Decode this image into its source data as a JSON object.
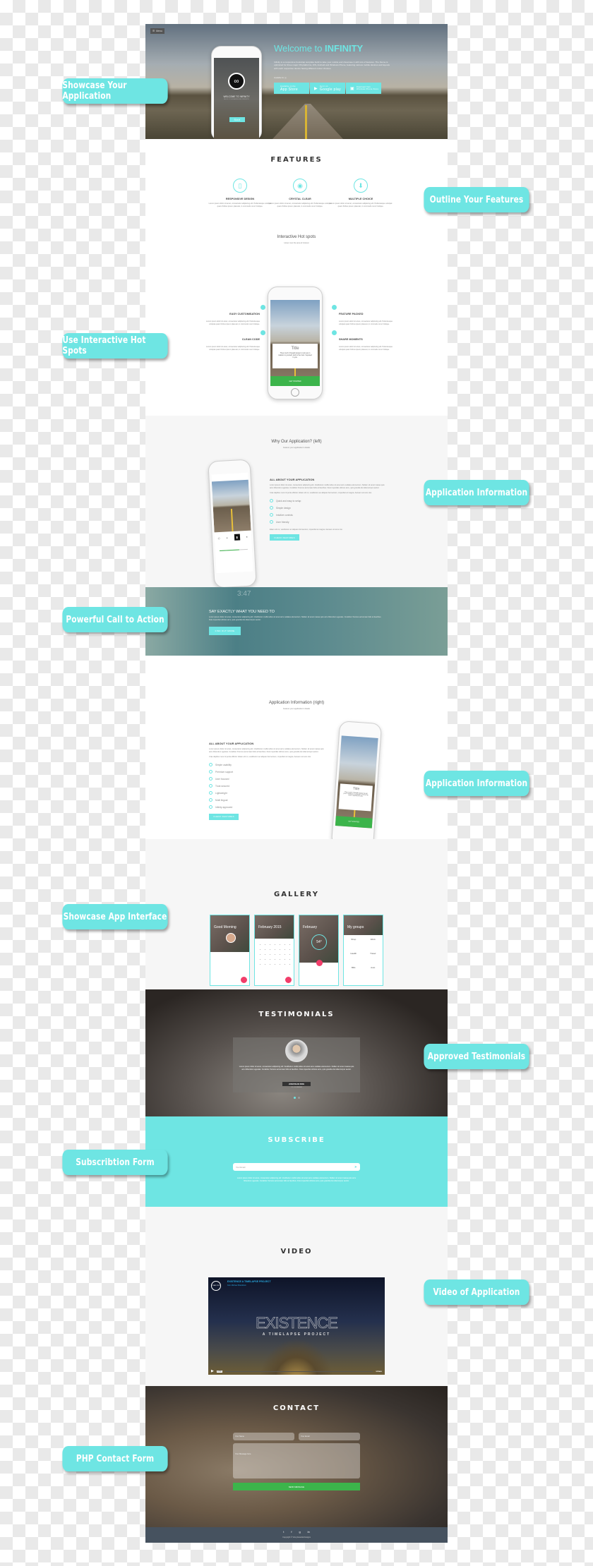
{
  "callouts": {
    "showcase_app": "Showcase Your Application",
    "outline_features": "Outline Your Features",
    "hot_spots": "Use Interactive Hot Spots",
    "app_info_1": "Application Information",
    "call_to_action": "Powerful Call to Action",
    "app_info_2": "Application Information",
    "showcase_interface": "Showcase App Interface",
    "testimonials": "Approved Testimonials",
    "subscription": "Subscribtion Form",
    "video": "Video of Application",
    "contact": "PHP Contact Form"
  },
  "hero": {
    "menu_label": "Menu",
    "title_prefix": "Welcome to ",
    "title_brand": "INFINITY",
    "description": "Infinity is a responsive bootstrap template build to take your mobile and showcase it with lots of features. The theme is optimized for three major OS platforms, iOS, Android and Windows Phone, featuring various mobile devices and layouts with each respective device having different colour choices.",
    "available_for": "Available for",
    "stores": [
      {
        "small": "Available on the",
        "big": "App Store",
        "icon": "apple-icon"
      },
      {
        "small": "Get it on",
        "big": "Google play",
        "icon": "google-play-icon"
      },
      {
        "small": "Download from",
        "big": "Windows Phone Store",
        "icon": "windows-icon"
      }
    ],
    "phone_welcome": "WELCOME TO INFINITY",
    "phone_sub": "BUILD YOUR AWESOME WEBSITE",
    "phone_button": "Start"
  },
  "features": {
    "title": "FEATURES",
    "items": [
      {
        "name": "RESPONSIVE DESIGN",
        "icon": "tablet-icon",
        "text": "Lorem ipsum dolor sit amet, consectetur adipiscing elit. Pellentesque volutpat quam finibus ipsum placerat, in commodo nunc tristique."
      },
      {
        "name": "CRYSTAL CLEAR",
        "icon": "eye-icon",
        "text": "Lorem ipsum dolor sit amet, consectetur adipiscing elit. Pellentesque volutpat quam finibus ipsum placerat, in commodo nunc tristique."
      },
      {
        "name": "MULTIPLE CHOICE",
        "icon": "download-icon",
        "text": "Lorem ipsum dolor sit amet, consectetur adipiscing elit. Pellentesque volutpat quam finibus ipsum placerat, in commodo nunc tristique."
      }
    ],
    "hot_title": "Interactive Hot spots",
    "hot_sub": "Hover over the area of interest",
    "hot_items": [
      {
        "name": "EASY CUSTOMISATION",
        "text": "Lorem ipsum dolor sit amet, consectetur adipiscing elit. Pellentesque volutpat quam finibus ipsum placerat, in commodo nunc tristique."
      },
      {
        "name": "CLEAN CODE",
        "text": "Lorem ipsum dolor sit amet, consectetur adipiscing elit. Pellentesque volutpat quam finibus ipsum placerat, in commodo nunc tristique."
      },
      {
        "name": "FEATURE PACKED",
        "text": "Lorem ipsum dolor sit amet, consectetur adipiscing elit. Pellentesque volutpat quam finibus ipsum placerat, in commodo nunc tristique."
      },
      {
        "name": "SHARE MOMENTS",
        "text": "Lorem ipsum dolor sit amet, consectetur adipiscing elit. Pellentesque volutpat quam finibus ipsum placerat, in commodo nunc tristique."
      }
    ],
    "phone_card_title": "Title",
    "phone_card_text": "Thus much I thought proper to tell you in relation to yourself, and to the trust I reposed in you.",
    "phone_button": "GET STARTED"
  },
  "why_left": {
    "title": "Why Our Application? (left)",
    "sub": "Feature your application's details",
    "heading": "ALL ABOUT YOUR APPLICATION",
    "para1": "Lorem ipsum dolor sit amet, consectetur adipiscing elit. Vestibulum mollis tellus sit amet arcu sodales elementum. Nullam sit amet massa quis arcu bibendum egestas. Curabitur rhoncus accumsan felis at faucibus. Duis imperdiet ultrices arcu, quis gravida dui ullamcorper auctor.",
    "para2": "Cras dapibus nunc id porta efficitur. Etiam elit mi, vestibulum ac aliquam fermentum, imperdiet at magna. Aenean vel eros nisi.",
    "checks": [
      "Quick and easy to setup",
      "Simple design",
      "Intuitive controls",
      "User friendly"
    ],
    "para3": "Etiam elit mi, vestibulum ac aliquam fermentum, imperdiet at magna. Aenean vel eros nisi.",
    "button": "CHECK FEATURES"
  },
  "cta": {
    "title": "SAY EXACTLY WHAT YOU NEED TO",
    "text": "Lorem ipsum dolor sit amet, consectetur adipiscing elit. Vestibulum mollis tellus sit amet arcu sodales elementum. Nullam sit amet massa quis arcu bibendum egestas. Curabitur rhoncus accumsan felis at faucibus. Duis imperdiet ultrices arcu, quis gravida dui ullamcorper auctor.",
    "button": "FIND OUT MORE",
    "phone_time": "3:47"
  },
  "app_right": {
    "title": "Application Information (right)",
    "sub": "Feature your application's details",
    "heading": "ALL ABOUT YOUR APPLICATION",
    "para1": "Lorem ipsum dolor sit amet, consectetur adipiscing elit. Vestibulum mollis tellus sit amet arcu sodales elementum. Nullam sit amet massa quis arcu bibendum egestas. Curabitur rhoncus accumsan felis at faucibus. Duis imperdiet ultrices arcu, quis gravida dui ullamcorper auctor.",
    "para2": "Cras dapibus nunc id porta efficitur. Etiam elit mi, vestibulum ac aliquam fermentum, imperdiet at magna. Aenean vel eros nisi.",
    "checks": [
      "Simple usability",
      "Premium support",
      "User focused",
      "Trust secured",
      "Lightweight",
      "Multi lingual",
      "Infinity approved"
    ],
    "button": "CHECK FEATURES",
    "phone_card_title": "Title",
    "phone_card_text": "Thus much I thought proper to tell you in relation to yourself, and to the trust I reposed in you.",
    "phone_button": "GET STARTED"
  },
  "gallery": {
    "title": "GALLERY",
    "cards": [
      {
        "title": "Good Morning",
        "type": "profile"
      },
      {
        "title": "February 2015",
        "type": "calendar"
      },
      {
        "title": "February",
        "type": "weather",
        "temp": "54°"
      },
      {
        "title": "My groups",
        "type": "groups",
        "groups": [
          "Shop",
          "Work",
          "Health",
          "Travel",
          "Bills",
          "Auto"
        ]
      }
    ],
    "active_dot": 0,
    "dots": 2
  },
  "testimonials": {
    "title": "TESTIMONIALS",
    "quote": "Lorem ipsum dolor sit amet, consectetur adipiscing elit. Vestibulum mollis tellus sit amet arcu sodales elementum. Nullam sit amet massa quis arcu bibendum egestas. Curabitur rhoncus accumsan felis at faucibus. Duis imperdiet ultrices arcu, quis gravida dui ullamcorper auctor.",
    "name": "JONATHAN DOE",
    "role": "CO. FOUNDER",
    "active_dot": 0,
    "dots": 2
  },
  "subscribe": {
    "title": "SUBSCRIBE",
    "placeholder": "Your Email",
    "text": "Lorem ipsum dolor sit amet, consectetur adipiscing elit. Vestibulum mollis tellus sit amet arcu sodales elementum. Nullam sit amet massa quis arcu bibendum egestas. Curabitur rhoncus accumsan felis at faucibus. Duis imperdiet ultrices arcu, quis gravida dui ullamcorper auctor."
  },
  "video": {
    "title": "VIDEO",
    "video_title": "EXISTENCE A TIMELAPSE PROJECT",
    "video_from": "from Michael Shainblum",
    "badge": "STAFF PICK",
    "big_title": "EXISTENCE",
    "big_sub": "A TIMELAPSE PROJECT",
    "time": "04:50",
    "provider": "vimeo"
  },
  "contact": {
    "title": "CONTACT",
    "name_placeholder": "Your Name",
    "email_placeholder": "Your Email",
    "message_placeholder": "Your Message here",
    "button": "SEND MESSAGE"
  },
  "footer": {
    "socials": [
      "twitter-icon",
      "facebook-icon",
      "google-plus-icon",
      "linkedin-icon"
    ],
    "copyright": "Copyright © Vinoj Ananda Designs"
  },
  "colors": {
    "accent": "#6ee5e3",
    "green": "#3cb44b",
    "footer": "#46525f"
  }
}
